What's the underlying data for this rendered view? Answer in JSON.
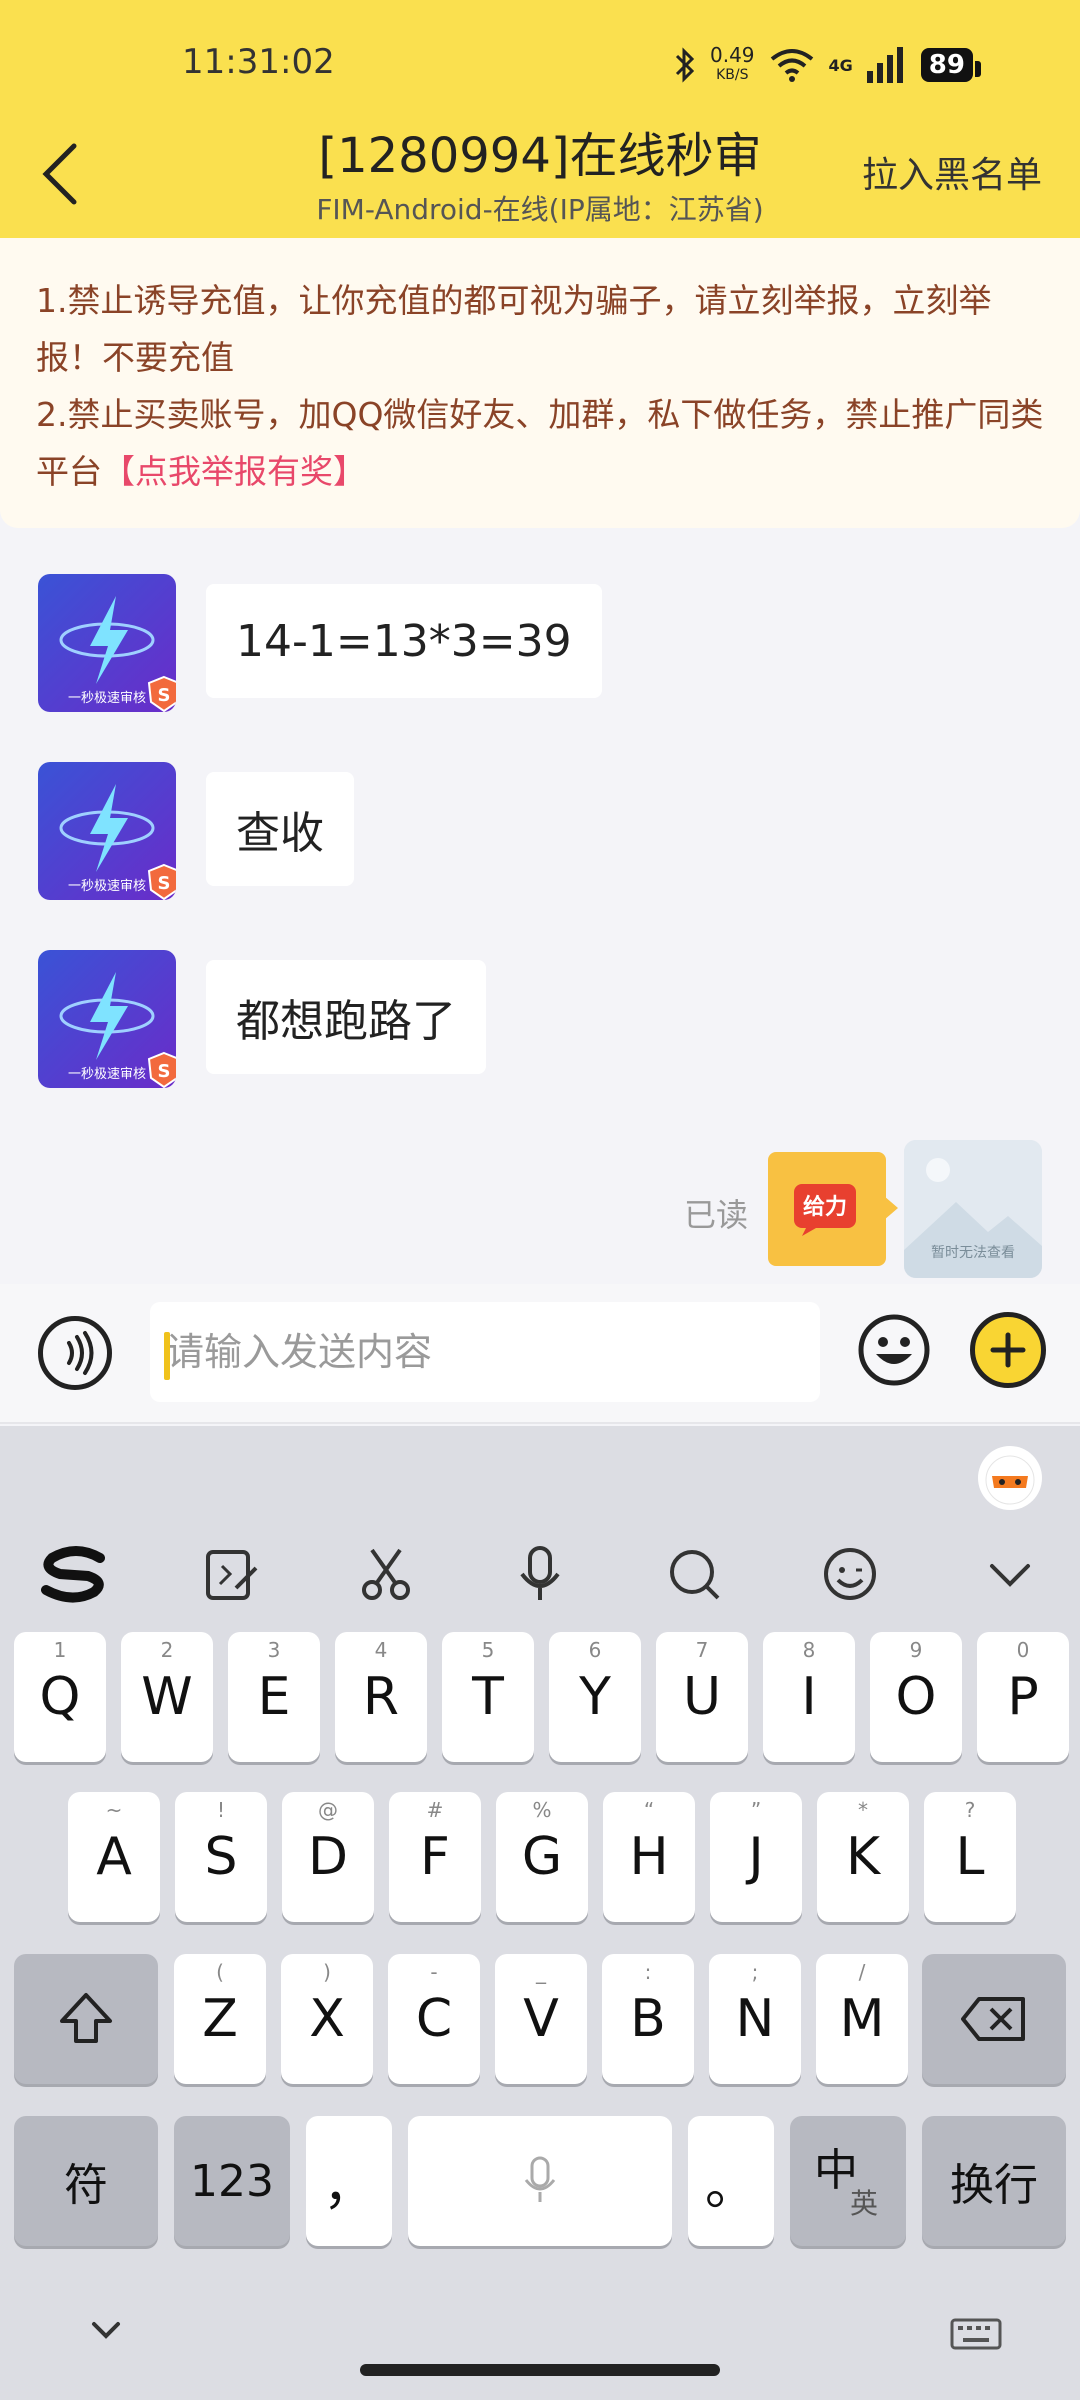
{
  "status_bar": {
    "time": "11:31:02",
    "net_speed_value": "0.49",
    "net_speed_unit": "KB/S",
    "network": "4G",
    "battery": "89"
  },
  "header": {
    "title": "[1280994]在线秒审",
    "subtitle": "FIM-Android-在线(IP属地：江苏省)",
    "blacklist_label": "拉入黑名单",
    "accent_color": "#fae04f"
  },
  "notice": {
    "line1": "1.禁止诱导充值，让你充值的都可视为骗子，请立刻举报，立刻举报！不要充值",
    "line2": "2.禁止买卖账号，加QQ微信好友、加群，私下做任务，禁止推广同类平台",
    "report_link": "【点我举报有奖】"
  },
  "messages": [
    {
      "text": "14-1=13*3=39",
      "avatar_caption": "一秒极速审核"
    },
    {
      "text": "查收",
      "avatar_caption": "一秒极速审核"
    },
    {
      "text": "都想跑路了",
      "avatar_caption": "一秒极速审核"
    }
  ],
  "my_message": {
    "read_status": "已读",
    "sticker_text": "给力",
    "avatar_caption": "暂时无法查看"
  },
  "input": {
    "placeholder": "请输入发送内容"
  },
  "keyboard": {
    "row1": [
      {
        "key": "Q",
        "hint": "1"
      },
      {
        "key": "W",
        "hint": "2"
      },
      {
        "key": "E",
        "hint": "3"
      },
      {
        "key": "R",
        "hint": "4"
      },
      {
        "key": "T",
        "hint": "5"
      },
      {
        "key": "Y",
        "hint": "6"
      },
      {
        "key": "U",
        "hint": "7"
      },
      {
        "key": "I",
        "hint": "8"
      },
      {
        "key": "O",
        "hint": "9"
      },
      {
        "key": "P",
        "hint": "0"
      }
    ],
    "row2": [
      {
        "key": "A",
        "hint": "~"
      },
      {
        "key": "S",
        "hint": "!"
      },
      {
        "key": "D",
        "hint": "@"
      },
      {
        "key": "F",
        "hint": "#"
      },
      {
        "key": "G",
        "hint": "%"
      },
      {
        "key": "H",
        "hint": "“"
      },
      {
        "key": "J",
        "hint": "”"
      },
      {
        "key": "K",
        "hint": "*"
      },
      {
        "key": "L",
        "hint": "?"
      }
    ],
    "row3": [
      {
        "key": "Z",
        "hint": "("
      },
      {
        "key": "X",
        "hint": ")"
      },
      {
        "key": "C",
        "hint": "-"
      },
      {
        "key": "V",
        "hint": "_"
      },
      {
        "key": "B",
        "hint": ":"
      },
      {
        "key": "N",
        "hint": ";"
      },
      {
        "key": "M",
        "hint": "/"
      }
    ],
    "symbols_label": "符",
    "numbers_label": "123",
    "comma_label": "，",
    "period_label": "。",
    "lang_main": "中",
    "lang_sub": "英",
    "enter_label": "换行"
  }
}
